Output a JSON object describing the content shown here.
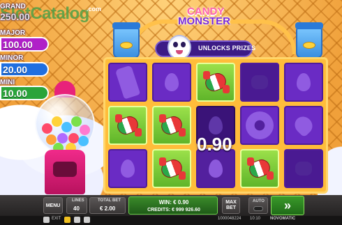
{
  "watermark": {
    "text": "SlotCatalog",
    "suffix": ".com"
  },
  "jackpots": {
    "grand": {
      "label": "GRAND",
      "value": "250.00"
    },
    "major": {
      "label": "MAJOR",
      "value": "100.00"
    },
    "minor": {
      "label": "MINOR",
      "value": "20.00"
    },
    "mini": {
      "label": "MINI",
      "value": "10.00"
    }
  },
  "logo": {
    "line1": "CANDY",
    "line2": "MONSTER"
  },
  "feature_banner": {
    "text": "UNLOCKS PRIZES"
  },
  "reels": {
    "rows": [
      [
        "popsicle",
        "candy-win",
        "wrapped-dark",
        "drop"
      ],
      [
        "candy-win",
        "candy-win",
        "donut",
        "heart"
      ],
      [
        "drop",
        "candy-win",
        "candy-win",
        "wrapped-dark"
      ]
    ],
    "center_win_amount": "0.90"
  },
  "controls": {
    "menu_label": "MENU",
    "lines_label": "LINES",
    "lines_value": "40",
    "total_bet_label": "TOTAL BET",
    "total_bet_value": "€ 2.00",
    "win_label": "WIN: € 0.90",
    "credits_label": "CREDITS: € 999 926.60",
    "max_bet_label": "MAX BET",
    "auto_label": "AUTO",
    "spin_symbol": "»"
  },
  "status_bar": {
    "exit_label": "EXIT",
    "session_id": "1000048224",
    "time": "10:10",
    "brand": "NOVOMATIC"
  },
  "colors": {
    "accent_green": "#3a9a2a",
    "reel_purple": "#6a2bc4",
    "frame_gold": "#ffbd3a"
  }
}
